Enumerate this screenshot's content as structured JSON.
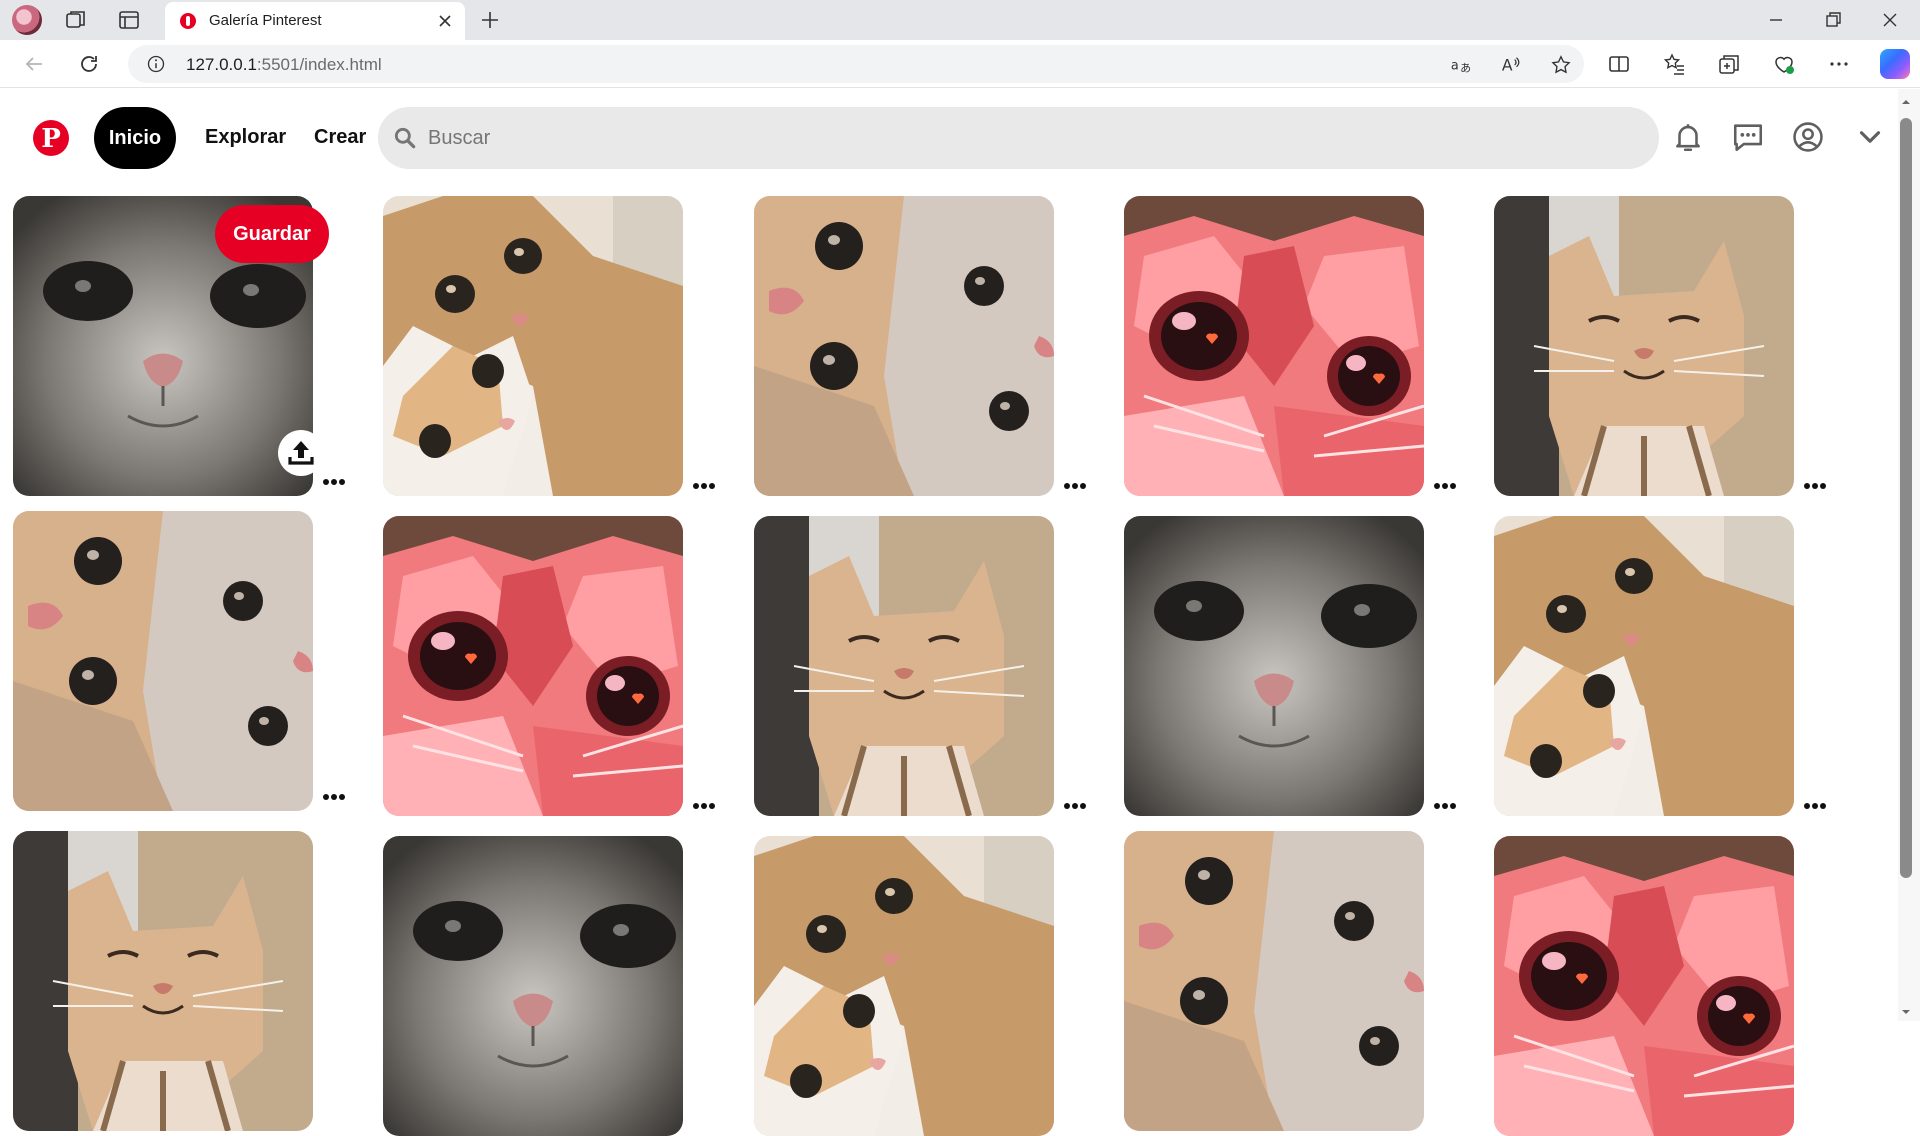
{
  "browser": {
    "tab_title": "Galería Pinterest",
    "url_host": "127.0.0.1",
    "url_rest": ":5501/index.html"
  },
  "header": {
    "logo_letter": "P",
    "home_label": "Inicio",
    "explore_label": "Explorar",
    "create_label": "Crear",
    "search_placeholder": "Buscar"
  },
  "hover_pin": {
    "save_label": "Guardar"
  },
  "pins": [
    {
      "image": "cat-white-closeup"
    },
    {
      "image": "cats-hugging"
    },
    {
      "image": "cats-selfie"
    },
    {
      "image": "cat-pink-art"
    },
    {
      "image": "cat-smiling-tabby"
    },
    {
      "image": "cats-selfie"
    },
    {
      "image": "cat-pink-art"
    },
    {
      "image": "cat-smiling-tabby"
    },
    {
      "image": "cat-white-closeup"
    },
    {
      "image": "cats-hugging"
    },
    {
      "image": "cat-smiling-tabby"
    },
    {
      "image": "cat-white-closeup"
    },
    {
      "image": "cats-hugging"
    },
    {
      "image": "cats-selfie"
    },
    {
      "image": "cat-pink-art"
    }
  ],
  "colors": {
    "brand": "#e60023",
    "search_bg": "#e9e9e9",
    "home_bg": "#000000"
  },
  "icons": [
    "pinterest-logo-icon",
    "search-icon",
    "bell-icon",
    "chat-icon",
    "user-icon",
    "chevron-down-icon",
    "upload-icon",
    "more-dots-icon"
  ]
}
